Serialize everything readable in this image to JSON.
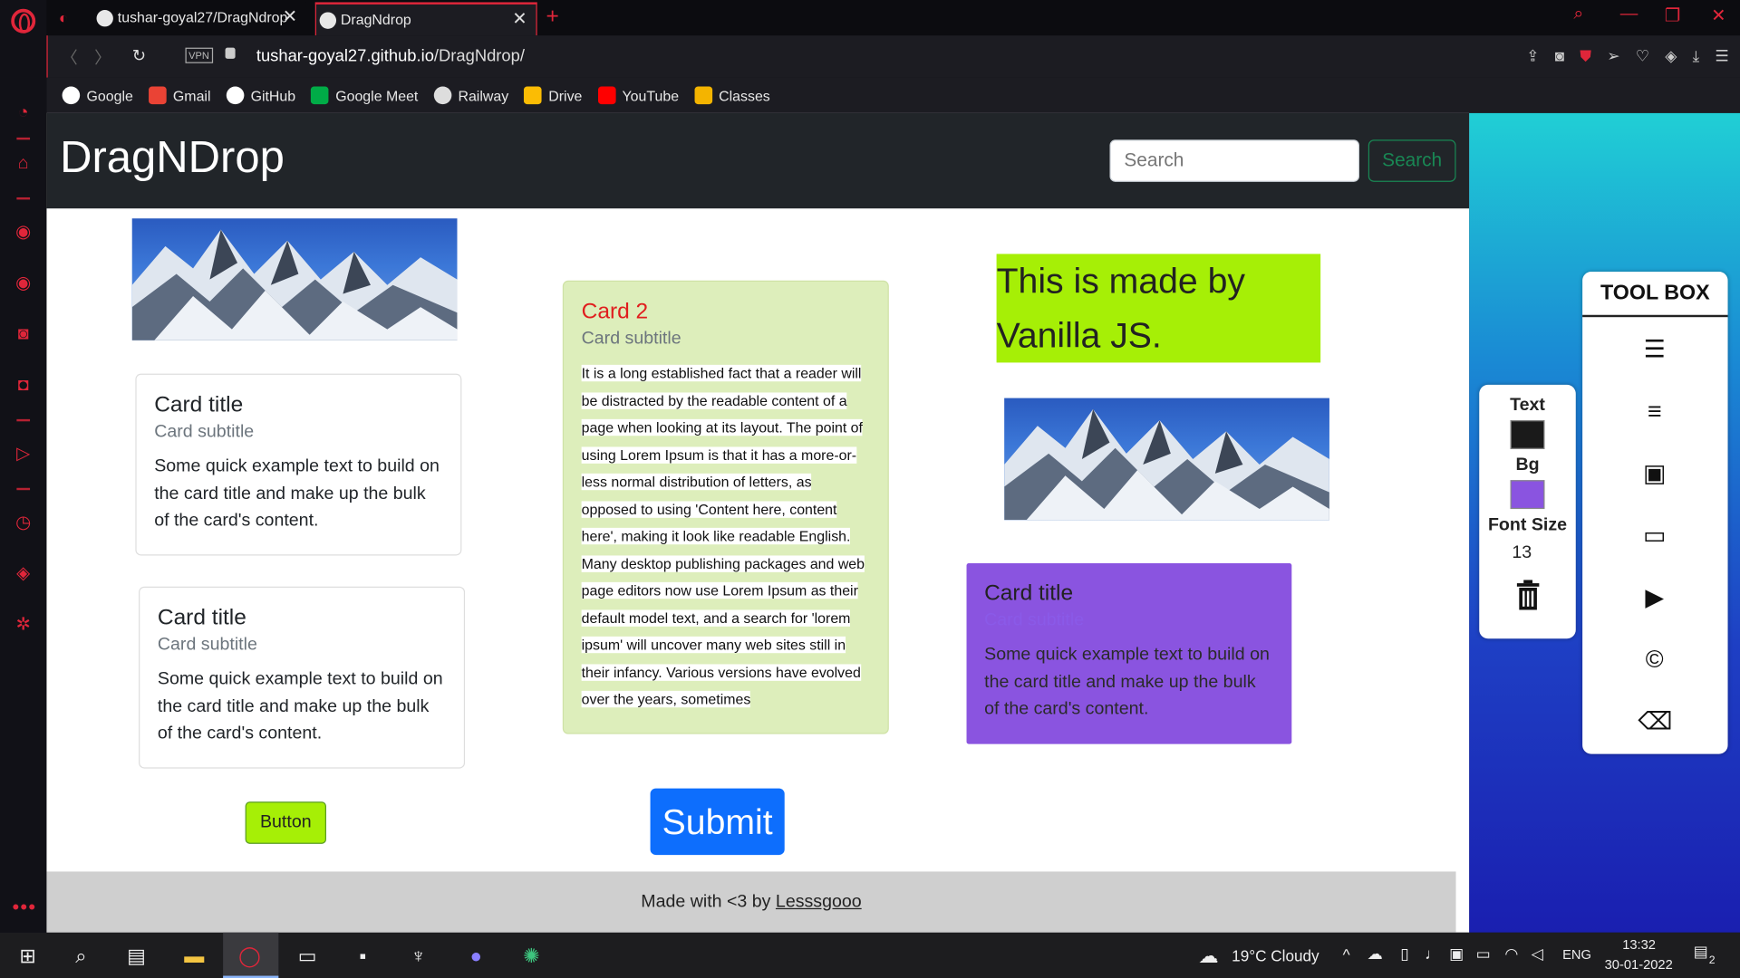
{
  "browser": {
    "tabs": [
      {
        "title": "tushar-goyal27/DragNdrop"
      },
      {
        "title": "DragNdrop"
      }
    ],
    "vpn_label": "VPN",
    "url_host": "tushar-goyal27.github.io",
    "url_path": "/DragNdrop/",
    "bookmarks": [
      "Google",
      "Gmail",
      "GitHub",
      "Google Meet",
      "Railway",
      "Drive",
      "YouTube",
      "Classes"
    ]
  },
  "page": {
    "brand": "DragNDrop",
    "search_placeholder": "Search",
    "search_button": "Search",
    "card1": {
      "title": "Card title",
      "subtitle": "Card subtitle",
      "text": "Some quick example text to build on the card title and make up the bulk of the card's content."
    },
    "card_left2": {
      "title": "Card title",
      "subtitle": "Card subtitle",
      "text": "Some quick example text to build on the card title and make up the bulk of the card's content."
    },
    "card2": {
      "title": "Card 2",
      "subtitle": "Card subtitle",
      "text": "It is a long established fact that a reader will be distracted by the readable content of a page when looking at its layout. The point of using Lorem Ipsum is that it has a more-or-less normal distribution of letters, as opposed to using 'Content here, content here', making it look like readable English. Many desktop publishing packages and web page editors now use Lorem Ipsum as their default model text, and a search for 'lorem ipsum' will uncover many web sites still in their infancy. Various versions have evolved over the years, sometimes"
    },
    "vanilla_text": "This is made by Vanilla JS.",
    "card_purple": {
      "title": "Card title",
      "subtitle": "Card subtitle",
      "text": "Some quick example text to build on the card title and make up the bulk of the card's content."
    },
    "button_label": "Button",
    "submit_label": "Submit",
    "footer_prefix": "Made with <3 by ",
    "footer_link": "Lesssgooo"
  },
  "props_panel": {
    "text_label": "Text",
    "text_color": "#1a1a1a",
    "bg_label": "Bg",
    "bg_color": "#8a54e0",
    "font_size_label": "Font Size",
    "font_size_value": "13"
  },
  "toolbox": {
    "title": "TOOL BOX",
    "items": [
      "list-icon",
      "align-center-icon",
      "image-icon",
      "card-icon",
      "play-icon",
      "copyright-icon",
      "trash-icon"
    ]
  },
  "taskbar": {
    "weather": "19°C  Cloudy",
    "lang": "ENG",
    "time": "13:32",
    "date": "30-01-2022",
    "notifications": "2"
  }
}
